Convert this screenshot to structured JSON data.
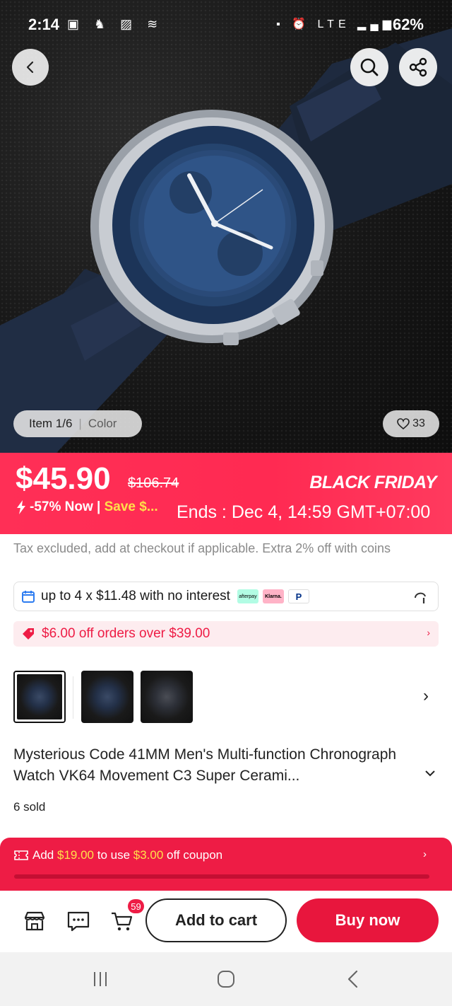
{
  "status_bar": {
    "time": "2:14",
    "network": "LTE",
    "battery": "62%"
  },
  "hero": {
    "item_counter": "Item 1/6",
    "color_label": "Color",
    "favorites_count": "33"
  },
  "price": {
    "current": "$45.90",
    "original": "$106.74",
    "discount": "-57% Now |",
    "save_text": "Save $...",
    "event_label": "BLACK FRIDAY",
    "ends_text": "Ends : Dec 4, 14:59 GMT+07:00"
  },
  "tax_note": "Tax excluded, add at checkout if applicable. Extra 2% off with coins",
  "installments": {
    "text": "up to 4 x $11.48 with no interest",
    "providers": [
      "afterpay",
      "Klarna.",
      "P"
    ]
  },
  "coupon": {
    "text": "$6.00 off orders over $39.00"
  },
  "product": {
    "title": "Mysterious Code 41MM Men's Multi-function Chronograph Watch VK64 Movement C3 Super Cerami...",
    "sold": "6 sold"
  },
  "promo_bar": {
    "prefix": "Add",
    "amount": "$19.00",
    "middle": "to use",
    "coupon_value": "$3.00",
    "suffix": "off coupon",
    "progress": 0.0
  },
  "actions": {
    "cart_count": "59",
    "add_to_cart": "Add to cart",
    "buy_now": "Buy now"
  },
  "colors": {
    "brand_red": "#ee1c45",
    "banner_red": "#ff2f56",
    "highlight_yellow": "#ffe04a"
  }
}
